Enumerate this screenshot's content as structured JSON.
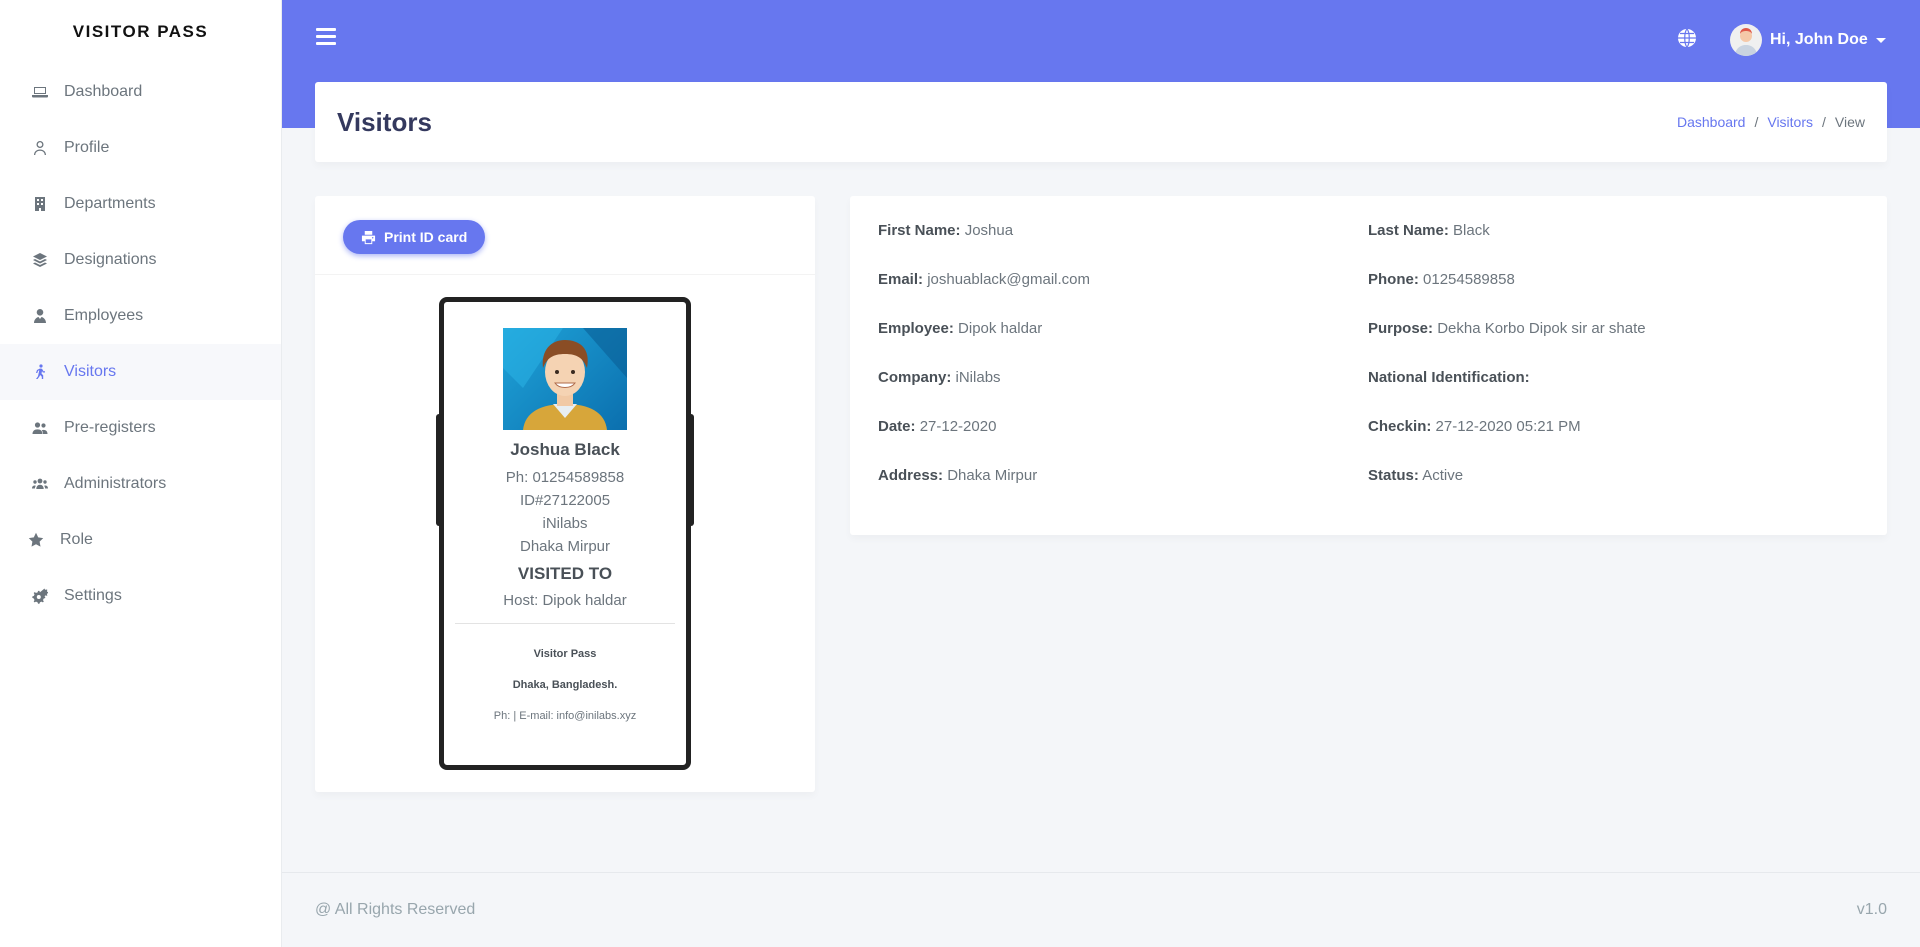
{
  "sidebar": {
    "brand": "VISITOR PASS",
    "items": [
      {
        "label": "Dashboard",
        "icon": "laptop-icon"
      },
      {
        "label": "Profile",
        "icon": "user-icon"
      },
      {
        "label": "Departments",
        "icon": "building-icon"
      },
      {
        "label": "Designations",
        "icon": "layers-icon"
      },
      {
        "label": "Employees",
        "icon": "user-tie-icon"
      },
      {
        "label": "Visitors",
        "icon": "walking-icon",
        "active": true
      },
      {
        "label": "Pre-registers",
        "icon": "user-friends-icon"
      },
      {
        "label": "Administrators",
        "icon": "users-icon"
      },
      {
        "label": "Role",
        "icon": "star-icon"
      },
      {
        "label": "Settings",
        "icon": "cogs-icon"
      }
    ]
  },
  "header": {
    "user_greeting": "Hi, John Doe"
  },
  "page": {
    "title": "Visitors",
    "breadcrumb": [
      "Dashboard",
      "Visitors",
      "View"
    ]
  },
  "print_button": "Print ID card",
  "id_card": {
    "name": "Joshua Black",
    "phone": "Ph: 01254589858",
    "id": "ID#27122005",
    "company": "iNilabs",
    "address": "Dhaka Mirpur",
    "visited_to": "VISITED TO",
    "host": "Host: Dipok haldar",
    "org": "Visitor Pass",
    "org_address": "Dhaka, Bangladesh.",
    "contact": "Ph: | E-mail: info@inilabs.xyz"
  },
  "details": {
    "first_name": {
      "label": "First Name:",
      "value": "Joshua"
    },
    "last_name": {
      "label": "Last Name:",
      "value": "Black"
    },
    "email": {
      "label": "Email:",
      "value": "joshuablack@gmail.com"
    },
    "phone": {
      "label": "Phone:",
      "value": "01254589858"
    },
    "employee": {
      "label": "Employee:",
      "value": "Dipok haldar"
    },
    "purpose": {
      "label": "Purpose:",
      "value": "Dekha Korbo Dipok sir ar shate"
    },
    "company": {
      "label": "Company:",
      "value": "iNilabs"
    },
    "national_id": {
      "label": "National Identification:",
      "value": ""
    },
    "date": {
      "label": "Date:",
      "value": "27-12-2020"
    },
    "checkin": {
      "label": "Checkin:",
      "value": "27-12-2020 05:21 PM"
    },
    "address": {
      "label": "Address:",
      "value": "Dhaka Mirpur"
    },
    "status": {
      "label": "Status:",
      "value": "Active"
    }
  },
  "footer": {
    "copyright": "@ All Rights Reserved",
    "version": "v1.0"
  },
  "colors": {
    "primary": "#6777ef",
    "title": "#34395e",
    "text": "#6c757d"
  }
}
